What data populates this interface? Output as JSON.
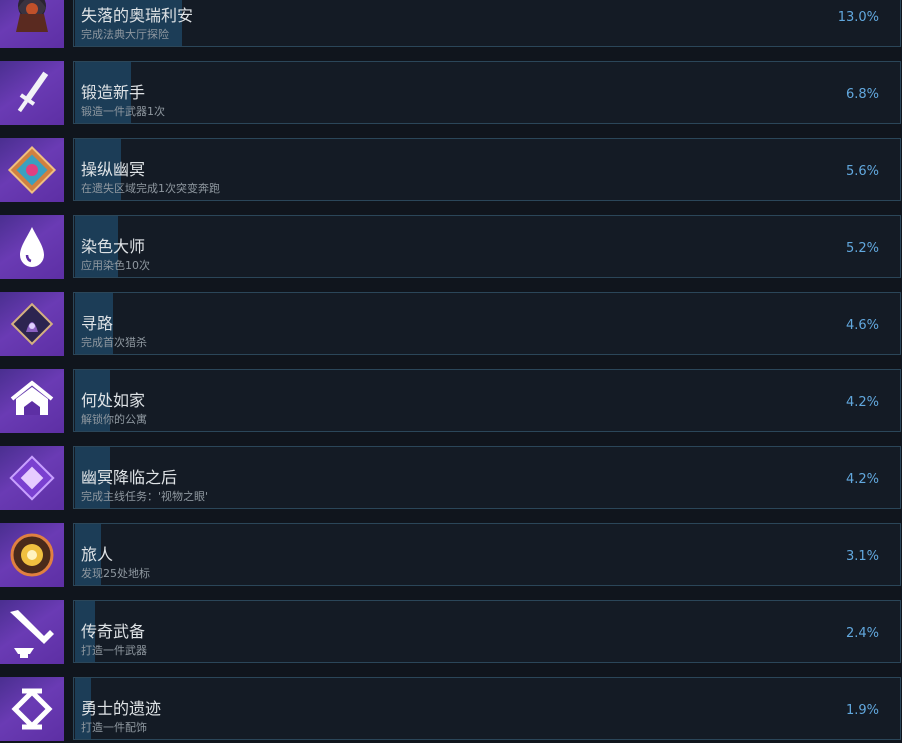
{
  "achievements": [
    {
      "title": "失落的奥瑞利安",
      "description": "完成法典大厅探险",
      "percent_label": "13.0%",
      "percent": 13.0,
      "icon": "hooded-figure-icon"
    },
    {
      "title": "锻造新手",
      "description": "锻造一件武器1次",
      "percent_label": "6.8%",
      "percent": 6.8,
      "icon": "dagger-icon"
    },
    {
      "title": "操纵幽冥",
      "description": "在遗失区域完成1次突变奔跑",
      "percent_label": "5.6%",
      "percent": 5.6,
      "icon": "crystal-diamond-icon"
    },
    {
      "title": "染色大师",
      "description": "应用染色10次",
      "percent_label": "5.2%",
      "percent": 5.2,
      "icon": "dye-drop-icon"
    },
    {
      "title": "寻路",
      "description": "完成首次猎杀",
      "percent_label": "4.6%",
      "percent": 4.6,
      "icon": "hooded-diamond-icon"
    },
    {
      "title": "何处如家",
      "description": "解锁你的公寓",
      "percent_label": "4.2%",
      "percent": 4.2,
      "icon": "home-icon"
    },
    {
      "title": "幽冥降临之后",
      "description": "完成主线任务：'视物之眼'",
      "percent_label": "4.2%",
      "percent": 4.2,
      "icon": "purple-crystal-icon"
    },
    {
      "title": "旅人",
      "description": "发现25处地标",
      "percent_label": "3.1%",
      "percent": 3.1,
      "icon": "compass-orb-icon"
    },
    {
      "title": "传奇武备",
      "description": "打造一件武器",
      "percent_label": "2.4%",
      "percent": 2.4,
      "icon": "sword-anvil-icon"
    },
    {
      "title": "勇士的遗迹",
      "description": "打造一件配饰",
      "percent_label": "1.9%",
      "percent": 1.9,
      "icon": "emblem-icon"
    }
  ],
  "colors": {
    "background": "#10151d",
    "panel": "#141b25",
    "panel_border": "#2b4659",
    "progress_fill": "#1c3d57",
    "title_text": "#dfe3e6",
    "description_text": "#8f98a0",
    "percent_text": "#62a8de"
  }
}
